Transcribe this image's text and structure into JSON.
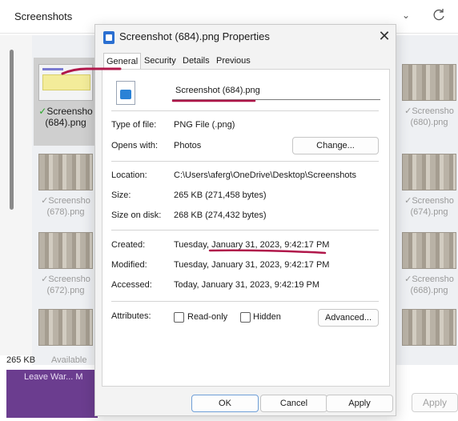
{
  "explorer": {
    "address": "Screenshots",
    "status_size": "265 KB",
    "status_avail": "Available",
    "taskbar_text": "Leave War... M",
    "bg_apply": "Apply",
    "thumbs": [
      {
        "label": "Screenshot (684).png",
        "line1": "Screensho",
        "line2": "(684).png",
        "selected": true
      },
      {
        "label": "Screenshot (680).png",
        "line1": "Screensho",
        "line2": "(680).png"
      },
      {
        "label": "Screenshot (678).png",
        "line1": "Screensho",
        "line2": "(678).png"
      },
      {
        "label": "Screenshot (674).png",
        "line1": "Screensho",
        "line2": "(674).png"
      },
      {
        "label": "Screenshot (672).png",
        "line1": "Screensho",
        "line2": "(672).png"
      },
      {
        "label": "Screenshot (668).png",
        "line1": "Screensho",
        "line2": "(668).png"
      }
    ]
  },
  "dialog": {
    "title": "Screenshot (684).png Properties",
    "tabs": [
      "General",
      "Security",
      "Details",
      "Previous Versions"
    ],
    "filename": "Screenshot (684).png",
    "type_label": "Type of file:",
    "type_value": "PNG File (.png)",
    "opens_label": "Opens with:",
    "opens_value": "Photos",
    "change_button": "Change...",
    "location_label": "Location:",
    "location_value": "C:\\Users\\aferg\\OneDrive\\Desktop\\Screenshots",
    "size_label": "Size:",
    "size_value": "265 KB (271,458 bytes)",
    "disk_label": "Size on disk:",
    "disk_value": "268 KB (274,432 bytes)",
    "created_label": "Created:",
    "created_value": "Tuesday, January 31, 2023, 9:42:17 PM",
    "modified_label": "Modified:",
    "modified_value": "Tuesday, January 31, 2023, 9:42:17 PM",
    "accessed_label": "Accessed:",
    "accessed_value": "Today, January 31, 2023, 9:42:19 PM",
    "attributes_label": "Attributes:",
    "readonly_label": "Read-only",
    "hidden_label": "Hidden",
    "advanced_button": "Advanced...",
    "ok_button": "OK",
    "cancel_button": "Cancel",
    "apply_button": "Apply"
  },
  "colors": {
    "annotation": "#b0174a",
    "accent": "#2a6fd1",
    "taskbar_tile": "#6b3d8f"
  }
}
